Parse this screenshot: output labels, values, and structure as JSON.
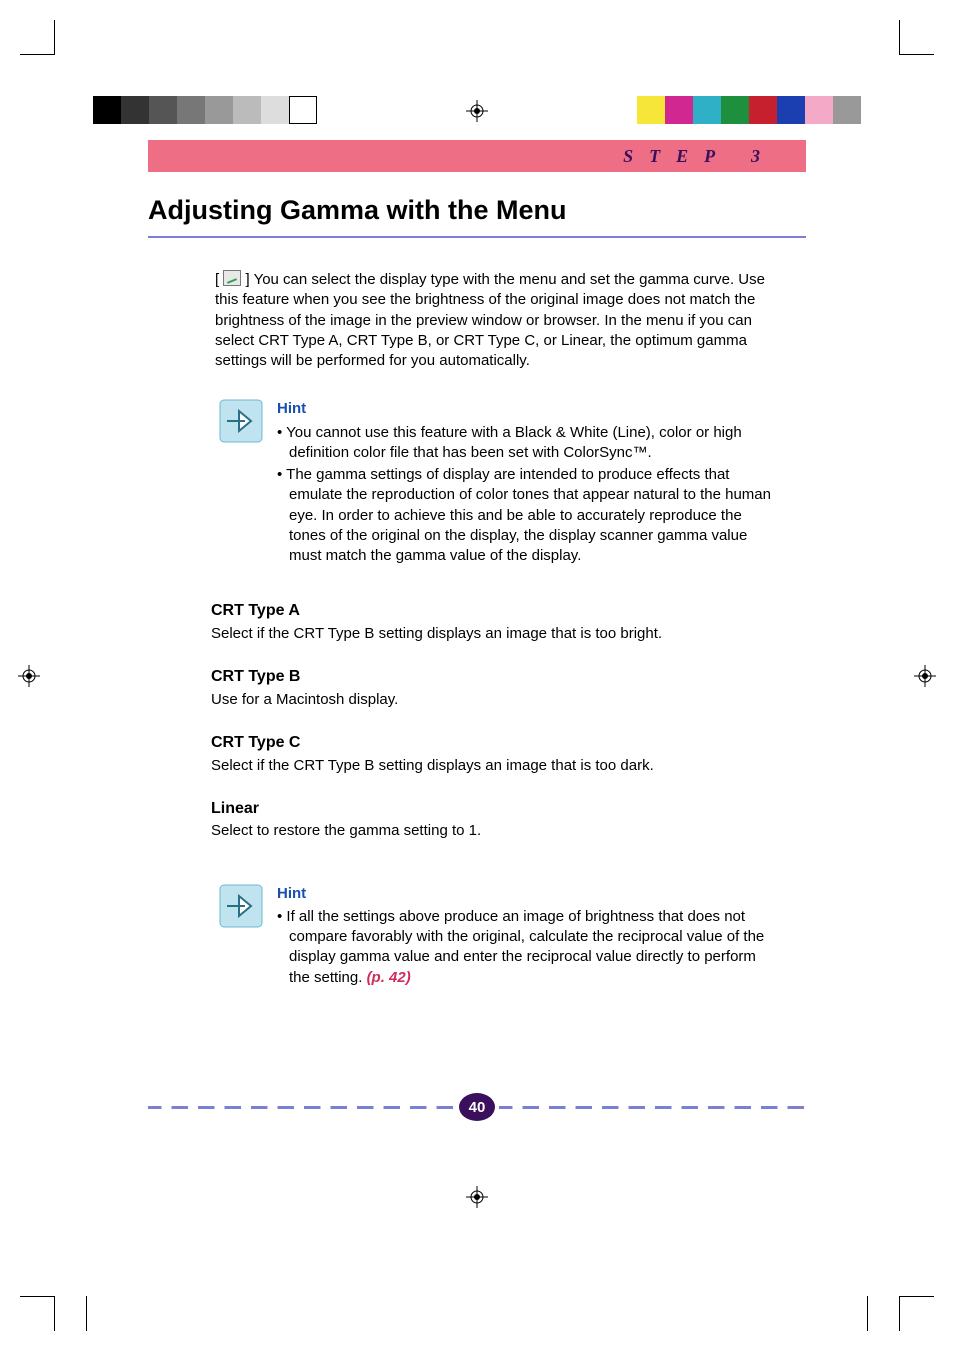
{
  "banner": {
    "text": "STEP 3"
  },
  "heading": "Adjusting Gamma with the Menu",
  "intro": {
    "icon_name": "gamma-menu-icon",
    "text": "You can select the display type with the menu and set the gamma curve.  Use this feature when you see the brightness of the original image does not match the brightness of the image in the preview window or browser.  In the menu if you can select CRT Type A, CRT Type B, or CRT Type C, or Linear, the optimum gamma settings will be performed for you automatically."
  },
  "hint1": {
    "title": "Hint",
    "items": [
      "You cannot use this feature with a Black & White (Line), color or high definition color file that has been set with ColorSync™.",
      "The gamma settings of display are intended to produce effects that emulate the reproduction of color tones that appear natural to the human eye.  In order to achieve this and be able to accurately reproduce the tones of the original on the display, the display scanner gamma value must match the gamma value of the display."
    ]
  },
  "sections": [
    {
      "title": "CRT Type A",
      "body": "Select if the CRT Type B setting displays an image that is too bright."
    },
    {
      "title": "CRT Type B",
      "body": "Use for a Macintosh display."
    },
    {
      "title": "CRT Type C",
      "body": "Select if the CRT Type B setting displays an image that is too dark."
    },
    {
      "title": "Linear",
      "body": "Select to restore the gamma setting to 1."
    }
  ],
  "hint2": {
    "title": "Hint",
    "item_text": "If all the settings above produce an image of brightness that does not compare favorably with the original, calculate the reciprocal value of the display gamma value and enter the reciprocal value directly to perform the setting. ",
    "page_ref": "(p. 42)"
  },
  "page_number": "40",
  "colorbar_left": [
    "#000000",
    "#333333",
    "#555555",
    "#777777",
    "#999999",
    "#bbbbbb",
    "#dddddd",
    "#ffffff"
  ],
  "colorbar_right": [
    "#f7e63a",
    "#d02790",
    "#2fb0c7",
    "#1d8f3d",
    "#c61f2d",
    "#1b3fb0",
    "#f4a9c7",
    "#999999"
  ]
}
